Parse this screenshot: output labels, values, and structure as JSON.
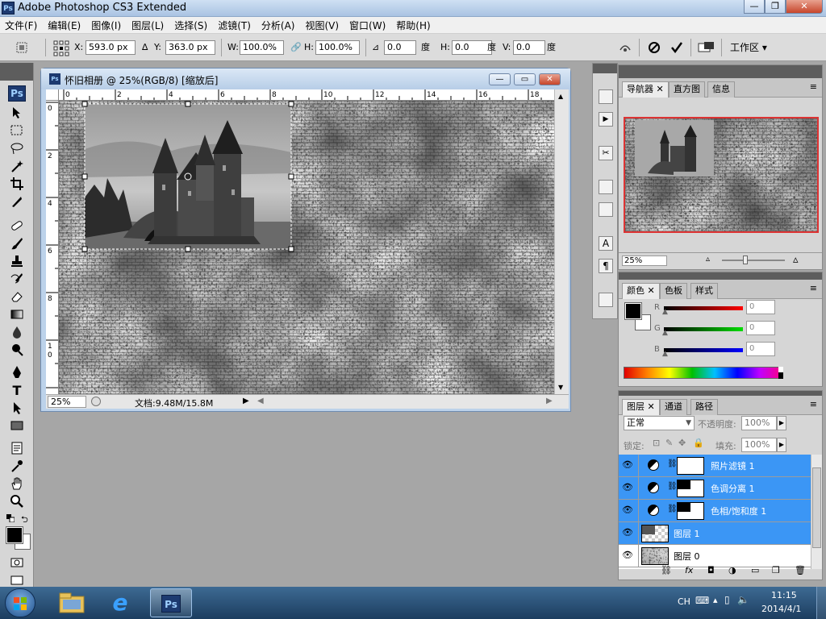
{
  "app": {
    "title": "Adobe Photoshop CS3 Extended",
    "logo": "Ps"
  },
  "menu": [
    "文件(F)",
    "编辑(E)",
    "图像(I)",
    "图层(L)",
    "选择(S)",
    "滤镜(T)",
    "分析(A)",
    "视图(V)",
    "窗口(W)",
    "帮助(H)"
  ],
  "options": {
    "x_label": "X:",
    "x_value": "593.0 px",
    "y_label": "Y:",
    "y_value": "363.0 px",
    "w_label": "W:",
    "w_value": "100.0%",
    "h_label": "H:",
    "h_value": "100.0%",
    "angle_value": "0.0",
    "angle_unit": "度",
    "hskew_label": "H:",
    "hskew_value": "0.0",
    "hskew_unit": "度",
    "vskew_label": "V:",
    "vskew_value": "0.0",
    "vskew_unit": "度",
    "workspace_label": "工作区"
  },
  "document": {
    "title": "怀旧相册 @ 25%(RGB/8) [缩放后]",
    "zoom": "25%",
    "doc_info": "文档:9.48M/15.8M",
    "ruler_top": [
      "0",
      "2",
      "4",
      "6",
      "8",
      "10",
      "12",
      "14",
      "16",
      "18"
    ],
    "ruler_left": [
      "0",
      "2",
      "4",
      "6",
      "8",
      "1\n0"
    ]
  },
  "navigator": {
    "tabs": [
      "导航器",
      "直方图",
      "信息"
    ],
    "zoom": "25%"
  },
  "color": {
    "tabs": [
      "颜色",
      "色板",
      "样式"
    ],
    "channels": [
      {
        "label": "R",
        "value": "0",
        "color": "#d01010"
      },
      {
        "label": "G",
        "value": "0",
        "color": "#10b010"
      },
      {
        "label": "B",
        "value": "0",
        "color": "#1020d0"
      }
    ]
  },
  "layers": {
    "tabs": [
      "图层",
      "通道",
      "路径"
    ],
    "blend_mode": "正常",
    "opacity_label": "不透明度:",
    "opacity_value": "100%",
    "lock_label": "锁定:",
    "fill_label": "填充:",
    "fill_value": "100%",
    "items": [
      {
        "name": "照片滤镜 1",
        "selected": true
      },
      {
        "name": "色调分离 1",
        "selected": true
      },
      {
        "name": "色相/饱和度 1",
        "selected": true
      },
      {
        "name": "图层 1",
        "selected": true
      },
      {
        "name": "图层 0",
        "selected": false
      }
    ]
  },
  "taskbar": {
    "lang": "CH",
    "time": "11:15",
    "date": "2014/4/1"
  }
}
